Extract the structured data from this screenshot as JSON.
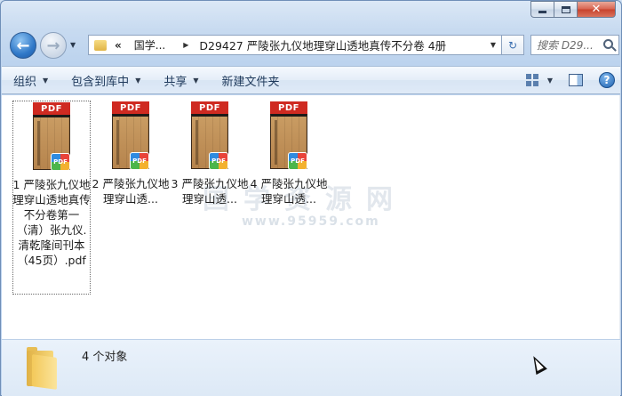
{
  "window": {
    "close_label": "✕"
  },
  "nav": {
    "back_glyph": "←",
    "forward_glyph": "→",
    "address_overflow": "«",
    "breadcrumb_root": "国学...",
    "breadcrumb_current": "D29427 严陵张九仪地理穿山透地真传不分卷 4册",
    "refresh_glyph": "↻",
    "search_placeholder": "搜索 D29..."
  },
  "commands": {
    "organize": "组织",
    "include_in_library": "包含到库中",
    "share": "共享",
    "new_folder": "新建文件夹",
    "help": "?"
  },
  "files": [
    {
      "label": "1 严陵张九仪地理穿山透地真传不分卷第一（清）张九仪.清乾隆间刊本（45页）.pdf",
      "type": "PDF",
      "selected": true
    },
    {
      "label": "2 严陵张九仪地理穿山透...",
      "type": "PDF",
      "selected": false
    },
    {
      "label": "3 严陵张九仪地理穿山透...",
      "type": "PDF",
      "selected": false
    },
    {
      "label": "4 严陵张九仪地理穿山透...",
      "type": "PDF",
      "selected": false
    }
  ],
  "watermark": {
    "title": "国学资源网",
    "url": "www.95959.com"
  },
  "status": {
    "count_text": "4 个对象"
  },
  "colors": {
    "pdf_red": "#cf2a21",
    "accent_blue": "#2f78c8"
  }
}
